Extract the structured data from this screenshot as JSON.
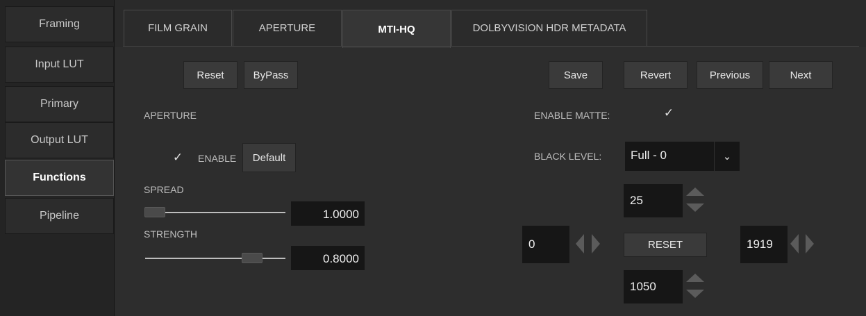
{
  "sidebar": {
    "items": [
      {
        "label": "Framing"
      },
      {
        "label": "Input LUT"
      },
      {
        "label": "Primary"
      },
      {
        "label": "Output LUT"
      },
      {
        "label": "Functions",
        "active": true
      },
      {
        "label": "Pipeline"
      }
    ]
  },
  "tabs": [
    {
      "label": "FILM GRAIN"
    },
    {
      "label": "APERTURE"
    },
    {
      "label": "MTI-HQ",
      "active": true
    },
    {
      "label": "DOLBYVISION HDR METADATA"
    }
  ],
  "toolbar": {
    "reset": "Reset",
    "bypass": "ByPass",
    "save": "Save",
    "revert": "Revert",
    "previous": "Previous",
    "next": "Next"
  },
  "aperture": {
    "section_label": "APERTURE",
    "enable_label": "ENABLE",
    "enable_checked": true,
    "default_button": "Default",
    "spread": {
      "label": "SPREAD",
      "value": "1.0000",
      "level": 0.0
    },
    "strength": {
      "label": "STRENGTH",
      "value": "0.8000",
      "level": 0.8
    }
  },
  "matte": {
    "enable_label": "ENABLE MATTE:",
    "enable_checked": true,
    "black_level_label": "BLACK LEVEL:",
    "black_level_value": "Full - 0",
    "top": "25",
    "left": "0",
    "right": "1919",
    "bottom": "1050",
    "reset_button": "RESET"
  },
  "icons": {
    "check": "✓",
    "chevron_down": "⌄"
  }
}
